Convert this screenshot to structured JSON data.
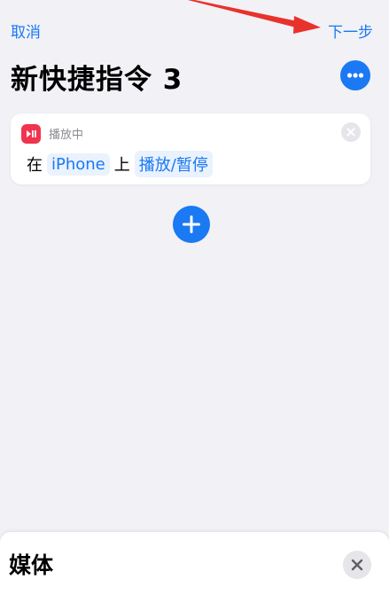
{
  "nav": {
    "cancel_label": "取消",
    "next_label": "下一步"
  },
  "shortcut": {
    "title": "新快捷指令 3"
  },
  "action_card": {
    "app_icon": "play-pause-icon",
    "header_label": "播放中",
    "sentence": {
      "word_1": "在",
      "device_token": "iPhone",
      "word_2": "上",
      "action_token": "播放/暂停"
    }
  },
  "bottom_sheet": {
    "title": "媒体"
  },
  "colors": {
    "accent": "#1a79f3",
    "app_icon_bg": "#f0334f",
    "background": "#f1f1f6",
    "annotation": "#e8322c"
  }
}
